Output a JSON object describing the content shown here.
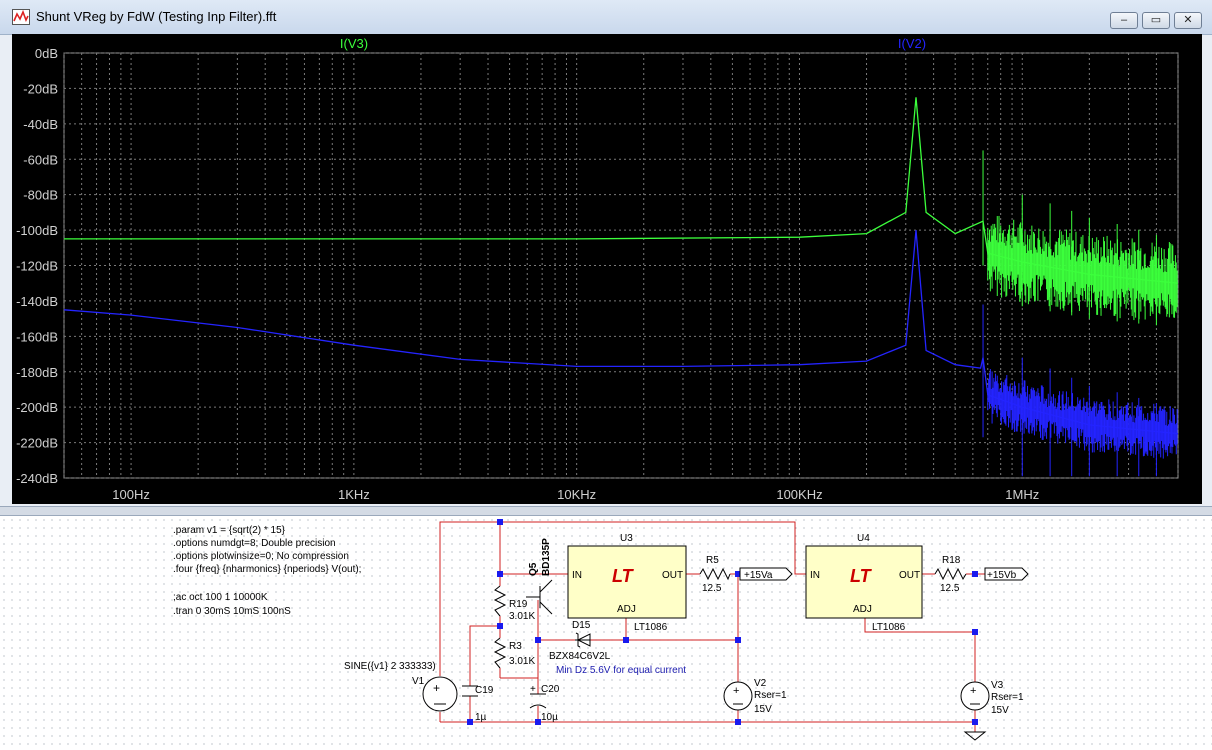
{
  "window": {
    "title": "Shunt VReg by FdW (Testing Inp Filter).fft",
    "buttons": {
      "minimize": "–",
      "restore": "▭",
      "close": "✕"
    }
  },
  "chart_data": {
    "type": "line",
    "x_scale": "log",
    "xlim_hz": [
      50,
      5000000
    ],
    "ylim_db": [
      -240,
      0
    ],
    "yticks": [
      "0dB",
      "-20dB",
      "-40dB",
      "-60dB",
      "-80dB",
      "-100dB",
      "-120dB",
      "-140dB",
      "-160dB",
      "-180dB",
      "-200dB",
      "-220dB",
      "-240dB"
    ],
    "xticks": [
      {
        "label": "100Hz",
        "value": 100
      },
      {
        "label": "1KHz",
        "value": 1000
      },
      {
        "label": "10KHz",
        "value": 10000
      },
      {
        "label": "100KHz",
        "value": 100000
      },
      {
        "label": "1MHz",
        "value": 1000000
      }
    ],
    "grid": true,
    "series": [
      {
        "name": "I(V3)",
        "color": "#3cff3c",
        "x": [
          50,
          100,
          1000,
          10000,
          100000,
          200000,
          300000,
          333333,
          370000,
          500000,
          666666,
          700000,
          1000000,
          2000000,
          5000000
        ],
        "y": [
          -105,
          -105,
          -105,
          -105,
          -104,
          -102,
          -90,
          -25,
          -90,
          -102,
          -95,
          -113,
          -118,
          -125,
          -130
        ]
      },
      {
        "name": "I(V2)",
        "color": "#2424ff",
        "x": [
          50,
          100,
          300,
          1000,
          3000,
          10000,
          30000,
          100000,
          200000,
          300000,
          333333,
          370000,
          500000,
          650000,
          666666,
          700000,
          1000000,
          2000000,
          5000000
        ],
        "y": [
          -145,
          -148,
          -155,
          -165,
          -173,
          -177,
          -177,
          -176,
          -174,
          -165,
          -100,
          -168,
          -176,
          -178,
          -172,
          -193,
          -200,
          -210,
          -215
        ]
      }
    ]
  },
  "schematic": {
    "directives": [
      ".param v1 = {sqrt(2) * 15}",
      ".options numdgt=8; Double precision",
      ".options plotwinsize=0; No compression",
      ".four {freq} {nharmonics} {nperiods} V(out);",
      ";ac oct 100 1 10000K",
      ".tran 0 30mS 10mS 100nS"
    ],
    "labels": {
      "q5": "Q5",
      "q5_part": "BD135P",
      "u3": "U3",
      "u4": "U4",
      "in": "IN",
      "out": "OUT",
      "adj": "ADJ",
      "lt1086_a": "LT1086",
      "lt1086_b": "LT1086",
      "r5": "R5",
      "r5_val": "12.5",
      "r18": "R18",
      "r18_val": "12.5",
      "r19": "R19",
      "r19_val": "3.01K",
      "r3": "R3",
      "r3_val": "3.01K",
      "d15": "D15",
      "d15_part": "BZX84C6V2L",
      "note": "Min Dz 5.6V for equal current",
      "net_a": "+15Va",
      "net_b": "+15Vb",
      "v1": "V1",
      "v1_src": "SINE({v1} 2 333333)",
      "v2": "V2",
      "v2_rser": "Rser=1",
      "v2_val": "15V",
      "v3": "V3",
      "v3_rser": "Rser=1",
      "v3_val": "15V",
      "c19": "C19",
      "c19_val": "1µ",
      "c20": "C20",
      "c20_val": "10µ",
      "lt_logo": "LT"
    }
  }
}
